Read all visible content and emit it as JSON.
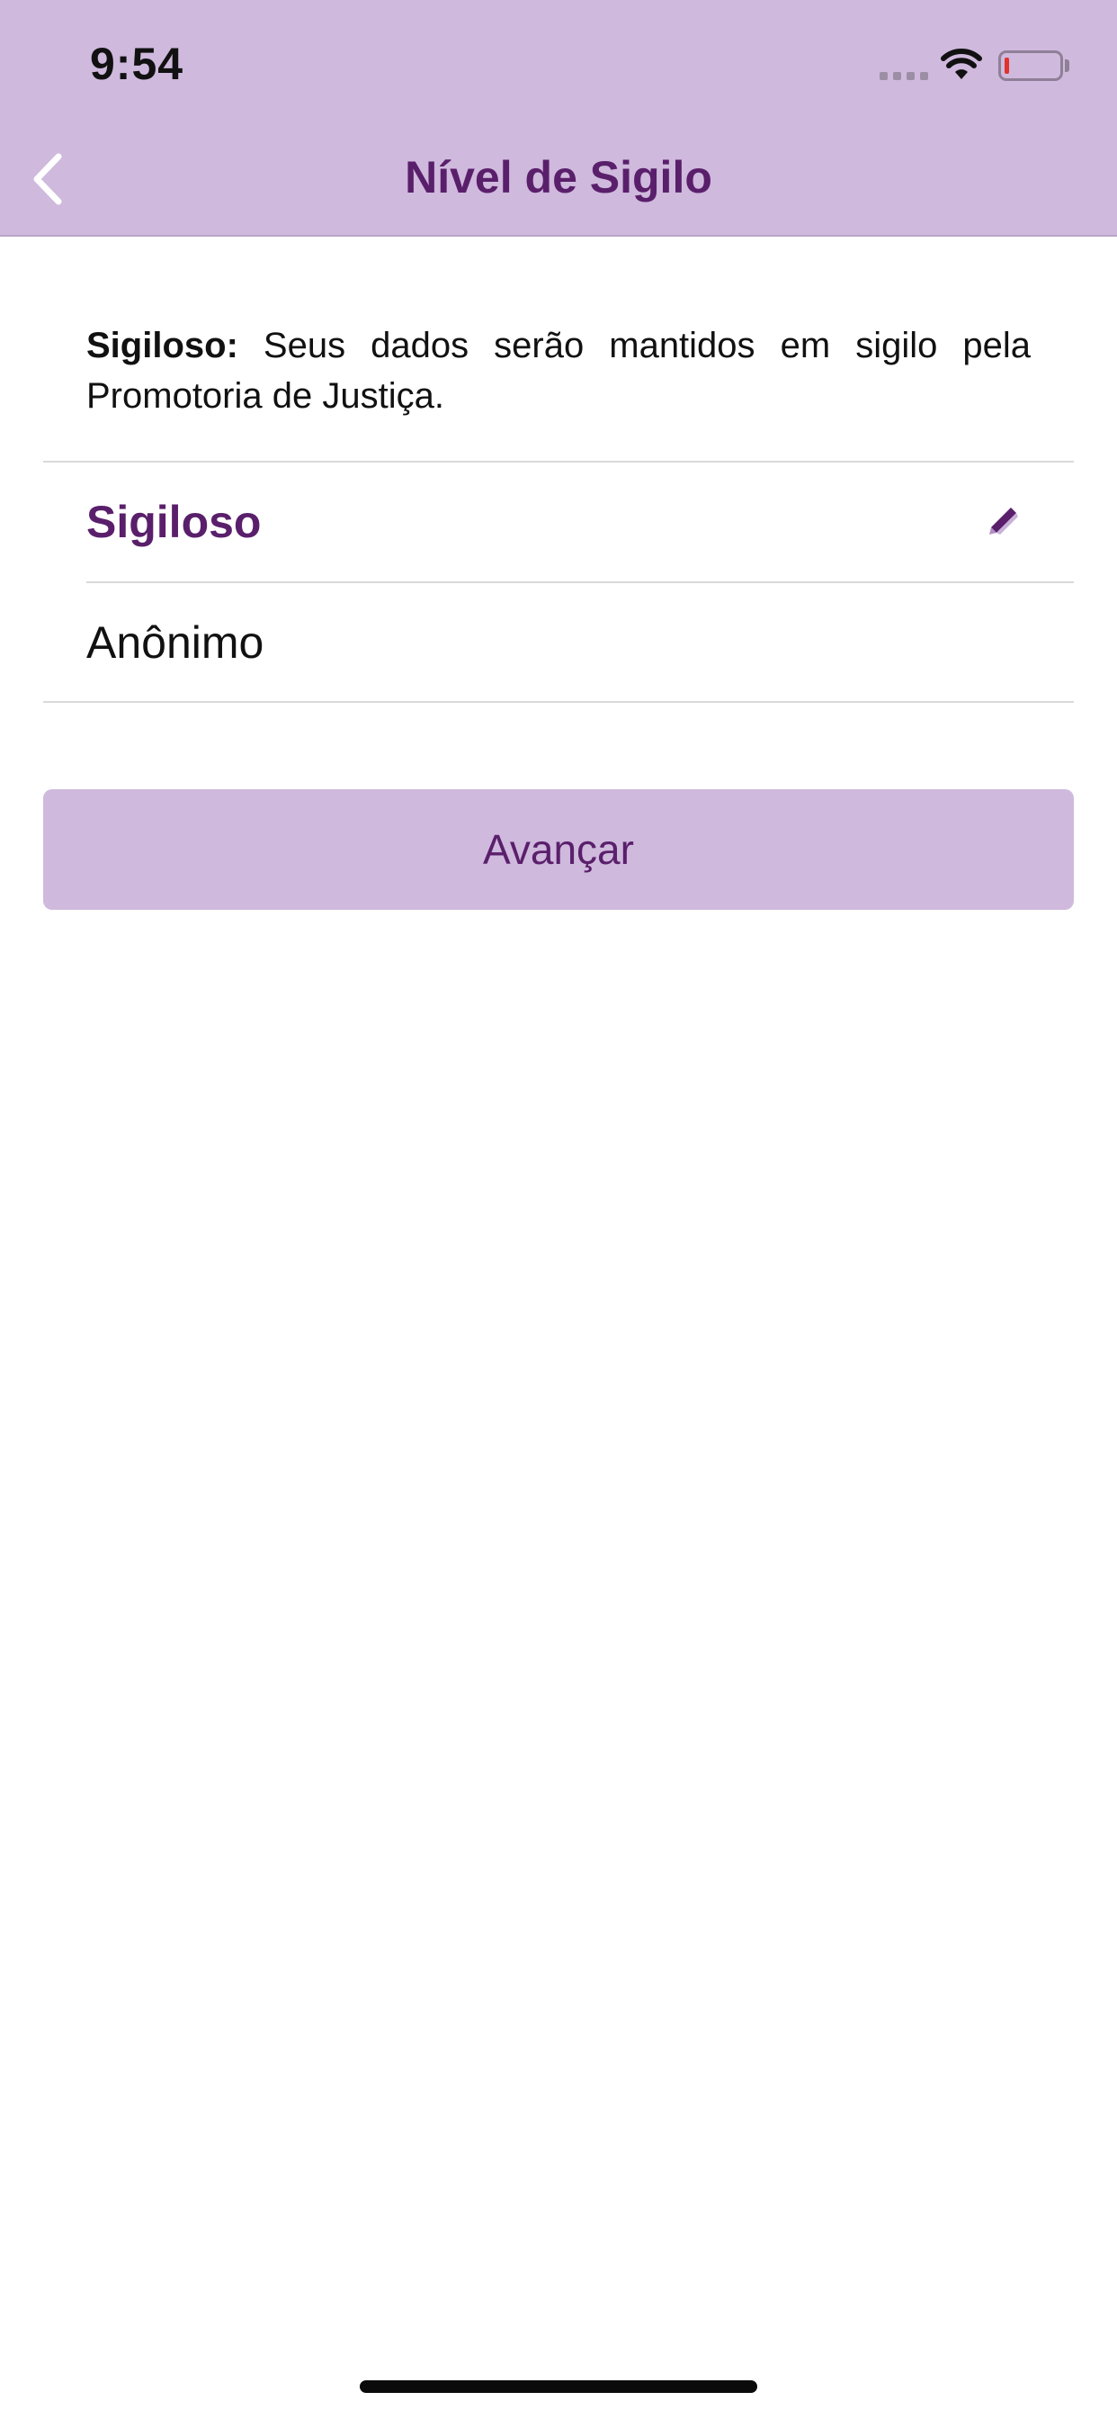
{
  "status_bar": {
    "time": "9:54",
    "signal_icon": "cellular-signal-icon",
    "wifi_icon": "wifi-icon",
    "battery_icon": "battery-icon"
  },
  "nav": {
    "title": "Nível de Sigilo",
    "back_icon": "chevron-left-icon"
  },
  "description": {
    "bold": "Sigiloso:",
    "text": " Seus dados serão mantidos em sigilo pela Promotoria de Justiça."
  },
  "options": [
    {
      "label": "Sigiloso",
      "selected": true
    },
    {
      "label": "Anônimo",
      "selected": false
    }
  ],
  "advance_button": {
    "label": "Avançar"
  },
  "colors": {
    "header_bg": "#cfb9dd",
    "accent": "#5a1f6b",
    "battery_low": "#e0322e"
  }
}
